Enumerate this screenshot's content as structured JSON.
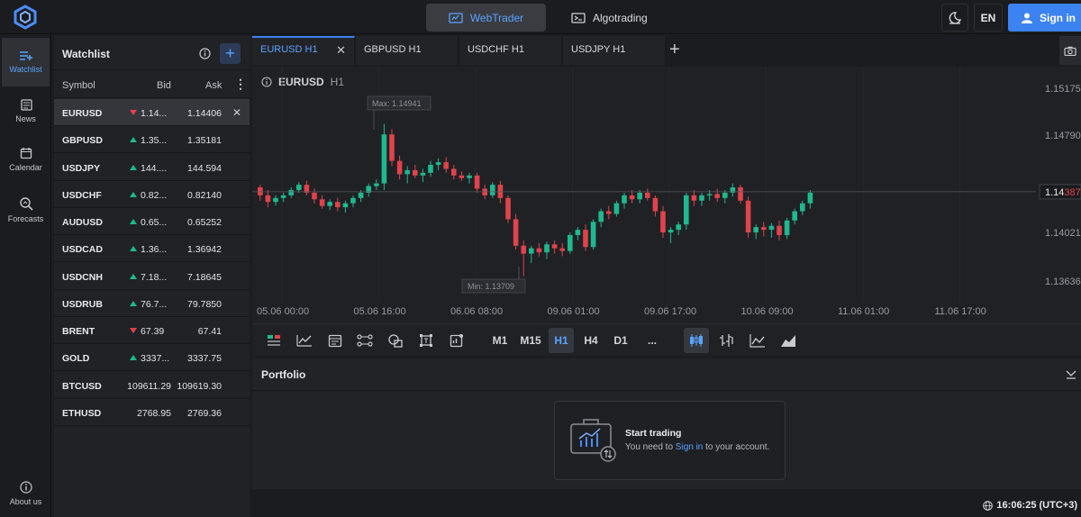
{
  "header": {
    "webtrader_label": "WebTrader",
    "algotrading_label": "Algotrading",
    "language": "EN",
    "signin_label": "Sign in"
  },
  "nav": {
    "watchlist": "Watchlist",
    "news": "News",
    "calendar": "Calendar",
    "forecasts": "Forecasts",
    "about": "About us"
  },
  "watchlist": {
    "title": "Watchlist",
    "columns": {
      "symbol": "Symbol",
      "bid": "Bid",
      "ask": "Ask"
    },
    "rows": [
      {
        "symbol": "EURUSD",
        "dir": "down",
        "bid": "1.14...",
        "ask": "1.14406"
      },
      {
        "symbol": "GBPUSD",
        "dir": "up",
        "bid": "1.35...",
        "ask": "1.35181"
      },
      {
        "symbol": "USDJPY",
        "dir": "up",
        "bid": "144....",
        "ask": "144.594"
      },
      {
        "symbol": "USDCHF",
        "dir": "up",
        "bid": "0.82...",
        "ask": "0.82140"
      },
      {
        "symbol": "AUDUSD",
        "dir": "up",
        "bid": "0.65...",
        "ask": "0.65252"
      },
      {
        "symbol": "USDCAD",
        "dir": "up",
        "bid": "1.36...",
        "ask": "1.36942"
      },
      {
        "symbol": "USDCNH",
        "dir": "up",
        "bid": "7.18...",
        "ask": "7.18645"
      },
      {
        "symbol": "USDRUB",
        "dir": "up",
        "bid": "76.7...",
        "ask": "79.7850"
      },
      {
        "symbol": "BRENT",
        "dir": "down",
        "bid": "67.39",
        "ask": "67.41"
      },
      {
        "symbol": "GOLD",
        "dir": "up",
        "bid": "3337...",
        "ask": "3337.75"
      },
      {
        "symbol": "BTCUSD",
        "dir": "none",
        "bid": "109611.29",
        "ask": "109619.30"
      },
      {
        "symbol": "ETHUSD",
        "dir": "none",
        "bid": "2768.95",
        "ask": "2769.36"
      }
    ]
  },
  "tabs": [
    "EURUSD H1",
    "GBPUSD H1",
    "USDCHF H1",
    "USDJPY H1"
  ],
  "chart": {
    "symbol": "EURUSD",
    "timeframe": "H1",
    "max_label": "Max: 1.14941",
    "min_label": "Min: 1.13709",
    "price_labels": [
      "1.15175",
      "1.14790",
      "1.14021",
      "1.13636"
    ],
    "current_price_main": "1.14",
    "current_price_tail": "387",
    "x_labels": [
      "05.06 00:00",
      "05.06 16:00",
      "06.06 08:00",
      "09.06 01:00",
      "09.06 17:00",
      "10.06 09:00",
      "11.06 01:00",
      "11.06 17:00"
    ]
  },
  "chart_data": {
    "type": "candlestick",
    "title": "EURUSD H1",
    "ylim": [
      1.1355,
      1.1525
    ],
    "max": 1.14941,
    "min": 1.13709,
    "current": 1.14387,
    "candles": [
      [
        1.1442,
        1.1444,
        1.1432,
        1.1436
      ],
      [
        1.1436,
        1.144,
        1.1427,
        1.1431
      ],
      [
        1.1431,
        1.1436,
        1.1428,
        1.1434
      ],
      [
        1.1434,
        1.1438,
        1.1431,
        1.1436
      ],
      [
        1.1436,
        1.1442,
        1.1434,
        1.144
      ],
      [
        1.144,
        1.1446,
        1.1438,
        1.1444
      ],
      [
        1.1444,
        1.1447,
        1.1436,
        1.1438
      ],
      [
        1.1438,
        1.1441,
        1.143,
        1.1433
      ],
      [
        1.1433,
        1.1436,
        1.1426,
        1.1428
      ],
      [
        1.1428,
        1.1433,
        1.1425,
        1.1431
      ],
      [
        1.1431,
        1.1434,
        1.1424,
        1.1427
      ],
      [
        1.1427,
        1.1432,
        1.1423,
        1.143
      ],
      [
        1.143,
        1.1436,
        1.1427,
        1.1434
      ],
      [
        1.1434,
        1.144,
        1.1431,
        1.1438
      ],
      [
        1.1438,
        1.1445,
        1.1435,
        1.1443
      ],
      [
        1.1443,
        1.1448,
        1.144,
        1.1445
      ],
      [
        1.1445,
        1.149,
        1.144,
        1.1482
      ],
      [
        1.1482,
        1.1486,
        1.1458,
        1.1462
      ],
      [
        1.1462,
        1.1466,
        1.1448,
        1.1452
      ],
      [
        1.1452,
        1.1458,
        1.1445,
        1.1455
      ],
      [
        1.1455,
        1.1459,
        1.1449,
        1.1451
      ],
      [
        1.1451,
        1.1456,
        1.1446,
        1.1453
      ],
      [
        1.1453,
        1.1462,
        1.145,
        1.1459
      ],
      [
        1.1459,
        1.1464,
        1.1455,
        1.1461
      ],
      [
        1.1461,
        1.1465,
        1.1453,
        1.1456
      ],
      [
        1.1456,
        1.1459,
        1.1448,
        1.1451
      ],
      [
        1.1451,
        1.1454,
        1.1447,
        1.1449
      ],
      [
        1.1449,
        1.1453,
        1.1445,
        1.1451
      ],
      [
        1.1451,
        1.1453,
        1.1438,
        1.1441
      ],
      [
        1.1441,
        1.1444,
        1.1433,
        1.1436
      ],
      [
        1.1436,
        1.1446,
        1.1434,
        1.1444
      ],
      [
        1.1444,
        1.1447,
        1.143,
        1.1434
      ],
      [
        1.1434,
        1.1436,
        1.1415,
        1.1418
      ],
      [
        1.1418,
        1.1422,
        1.1395,
        1.1398
      ],
      [
        1.1398,
        1.1402,
        1.1375,
        1.1392
      ],
      [
        1.1392,
        1.1398,
        1.1385,
        1.1396
      ],
      [
        1.1396,
        1.14,
        1.139,
        1.1393
      ],
      [
        1.1393,
        1.1401,
        1.1388,
        1.1399
      ],
      [
        1.1399,
        1.1402,
        1.1392,
        1.1396
      ],
      [
        1.1396,
        1.14,
        1.139,
        1.1394
      ],
      [
        1.1394,
        1.1408,
        1.1392,
        1.1406
      ],
      [
        1.1406,
        1.1412,
        1.1402,
        1.141
      ],
      [
        1.141,
        1.1414,
        1.1394,
        1.1397
      ],
      [
        1.1397,
        1.1418,
        1.1395,
        1.1416
      ],
      [
        1.1416,
        1.1426,
        1.1412,
        1.1424
      ],
      [
        1.1424,
        1.1428,
        1.1418,
        1.1422
      ],
      [
        1.1422,
        1.1432,
        1.142,
        1.143
      ],
      [
        1.143,
        1.1438,
        1.1426,
        1.1436
      ],
      [
        1.1436,
        1.144,
        1.143,
        1.1433
      ],
      [
        1.1433,
        1.144,
        1.143,
        1.1438
      ],
      [
        1.1438,
        1.1441,
        1.1432,
        1.1434
      ],
      [
        1.1434,
        1.1436,
        1.142,
        1.1424
      ],
      [
        1.1424,
        1.1428,
        1.1404,
        1.1408
      ],
      [
        1.1408,
        1.1412,
        1.14,
        1.141
      ],
      [
        1.141,
        1.1416,
        1.1406,
        1.1414
      ],
      [
        1.1414,
        1.1438,
        1.141,
        1.1436
      ],
      [
        1.1436,
        1.144,
        1.1428,
        1.1432
      ],
      [
        1.1432,
        1.1438,
        1.1428,
        1.1436
      ],
      [
        1.1436,
        1.144,
        1.1432,
        1.1437
      ],
      [
        1.1437,
        1.1441,
        1.1431,
        1.1434
      ],
      [
        1.1434,
        1.144,
        1.143,
        1.1438
      ],
      [
        1.1438,
        1.1445,
        1.1435,
        1.1442
      ],
      [
        1.1442,
        1.1444,
        1.143,
        1.1432
      ],
      [
        1.1432,
        1.1435,
        1.1404,
        1.1408
      ],
      [
        1.1408,
        1.1414,
        1.1403,
        1.1412
      ],
      [
        1.1412,
        1.1416,
        1.1405,
        1.141
      ],
      [
        1.141,
        1.1415,
        1.1404,
        1.1413
      ],
      [
        1.1413,
        1.1417,
        1.1402,
        1.1406
      ],
      [
        1.1406,
        1.1419,
        1.1403,
        1.1417
      ],
      [
        1.1417,
        1.1426,
        1.1414,
        1.1424
      ],
      [
        1.1424,
        1.1432,
        1.1421,
        1.143
      ],
      [
        1.143,
        1.144,
        1.1426,
        1.1438
      ]
    ]
  },
  "toolbar": {
    "timeframes": [
      "M1",
      "M15",
      "H1",
      "H4",
      "D1",
      "..."
    ],
    "active_tf": "H1"
  },
  "portfolio": {
    "title": "Portfolio",
    "start_title": "Start trading",
    "start_pre": "You need to ",
    "start_link": "Sign in",
    "start_post": " to your account."
  },
  "status": {
    "clock": "16:06:25 (UTC+3)"
  },
  "colors": {
    "accent": "#3c82f0",
    "up": "#1fb890",
    "down": "#e0434b"
  }
}
